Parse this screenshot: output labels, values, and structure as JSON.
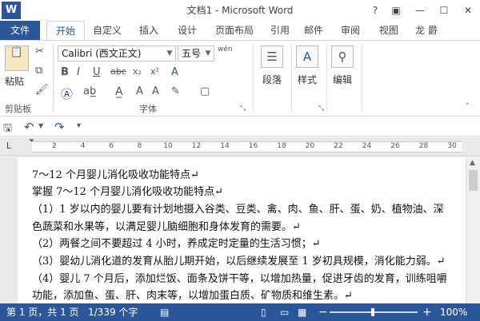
{
  "window": {
    "title": "文档1 - Microsoft Word",
    "app_logo": "W",
    "help": "?",
    "ribbon_display": "▣",
    "minimize": "—",
    "maximize": "☐",
    "close": "✕"
  },
  "tabs": {
    "file": "文件",
    "home": "开始",
    "custom": "自定义",
    "insert": "插入",
    "design": "设计",
    "layout": "页面布局",
    "references": "引用",
    "mailings": "邮件",
    "review": "审阅",
    "view": "视图",
    "user": "龙 爵"
  },
  "ribbon": {
    "clipboard": {
      "paste_label": "粘贴",
      "group_label": "剪贴板"
    },
    "font": {
      "font_name": "Calibri (西文正文)",
      "font_size": "五号",
      "phonetic": "wén",
      "bold": "B",
      "italic": "I",
      "underline": "U",
      "strike": "abc",
      "subscript": "x₂",
      "superscript": "x²",
      "group_label": "字体"
    },
    "paragraph": {
      "label": "段落"
    },
    "styles": {
      "label": "样式"
    },
    "editing": {
      "label": "编辑"
    }
  },
  "ruler": {
    "tab_selector": "L",
    "ticks": [
      "2",
      "4",
      "6",
      "8",
      "10",
      "12",
      "14",
      "16",
      "18",
      "20",
      "22",
      "24",
      "26",
      "28",
      "30"
    ]
  },
  "document": {
    "lines": [
      "7～12 个月婴儿消化吸收功能特点↵",
      "掌握 7～12 个月婴儿消化吸收功能特点↵",
      "（1）1 岁以内的婴儿要有计划地摄入谷类、豆类、禽、肉、鱼、肝、蛋、奶、植物油、深",
      "色蔬菜和水果等，以满足婴儿脑细胞和身体发育的需要。↵",
      "（2）两餐之间不要超过 4 小时，养成定时定量的生活习惯；↵",
      "（3）婴幼儿消化道的发育从胎儿期开始，以后继续发展至 1 岁初具规模，消化能力弱。↵",
      "（4）婴儿 7 个月后，添加烂饭、面条及饼干等，以增加热量，促进牙齿的发育，训练咀嚼",
      "功能，添加鱼、蛋、肝、肉末等，以增加蛋白质、矿物质和维生素。↵"
    ]
  },
  "status": {
    "page": "第 1 页，共 1 页",
    "words": "1/339 个字",
    "zoom": "100%",
    "zoom_minus": "−",
    "zoom_plus": "+"
  }
}
